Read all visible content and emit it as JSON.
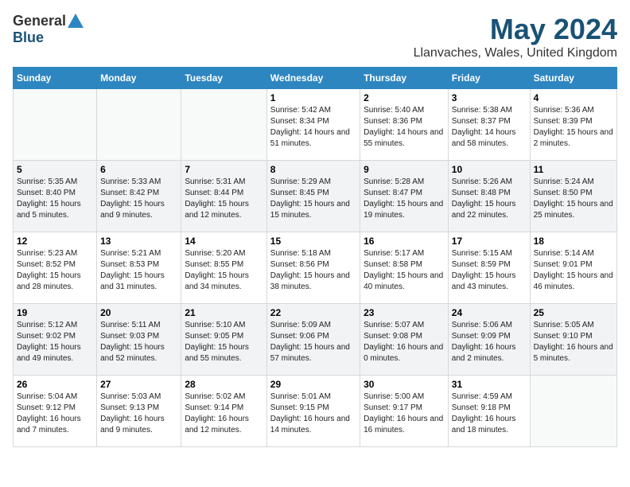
{
  "logo": {
    "general": "General",
    "blue": "Blue"
  },
  "title": "May 2024",
  "subtitle": "Llanvaches, Wales, United Kingdom",
  "days_of_week": [
    "Sunday",
    "Monday",
    "Tuesday",
    "Wednesday",
    "Thursday",
    "Friday",
    "Saturday"
  ],
  "weeks": [
    [
      {
        "day": null,
        "info": null
      },
      {
        "day": null,
        "info": null
      },
      {
        "day": null,
        "info": null
      },
      {
        "day": "1",
        "sunrise": "Sunrise: 5:42 AM",
        "sunset": "Sunset: 8:34 PM",
        "daylight": "Daylight: 14 hours and 51 minutes."
      },
      {
        "day": "2",
        "sunrise": "Sunrise: 5:40 AM",
        "sunset": "Sunset: 8:36 PM",
        "daylight": "Daylight: 14 hours and 55 minutes."
      },
      {
        "day": "3",
        "sunrise": "Sunrise: 5:38 AM",
        "sunset": "Sunset: 8:37 PM",
        "daylight": "Daylight: 14 hours and 58 minutes."
      },
      {
        "day": "4",
        "sunrise": "Sunrise: 5:36 AM",
        "sunset": "Sunset: 8:39 PM",
        "daylight": "Daylight: 15 hours and 2 minutes."
      }
    ],
    [
      {
        "day": "5",
        "sunrise": "Sunrise: 5:35 AM",
        "sunset": "Sunset: 8:40 PM",
        "daylight": "Daylight: 15 hours and 5 minutes."
      },
      {
        "day": "6",
        "sunrise": "Sunrise: 5:33 AM",
        "sunset": "Sunset: 8:42 PM",
        "daylight": "Daylight: 15 hours and 9 minutes."
      },
      {
        "day": "7",
        "sunrise": "Sunrise: 5:31 AM",
        "sunset": "Sunset: 8:44 PM",
        "daylight": "Daylight: 15 hours and 12 minutes."
      },
      {
        "day": "8",
        "sunrise": "Sunrise: 5:29 AM",
        "sunset": "Sunset: 8:45 PM",
        "daylight": "Daylight: 15 hours and 15 minutes."
      },
      {
        "day": "9",
        "sunrise": "Sunrise: 5:28 AM",
        "sunset": "Sunset: 8:47 PM",
        "daylight": "Daylight: 15 hours and 19 minutes."
      },
      {
        "day": "10",
        "sunrise": "Sunrise: 5:26 AM",
        "sunset": "Sunset: 8:48 PM",
        "daylight": "Daylight: 15 hours and 22 minutes."
      },
      {
        "day": "11",
        "sunrise": "Sunrise: 5:24 AM",
        "sunset": "Sunset: 8:50 PM",
        "daylight": "Daylight: 15 hours and 25 minutes."
      }
    ],
    [
      {
        "day": "12",
        "sunrise": "Sunrise: 5:23 AM",
        "sunset": "Sunset: 8:52 PM",
        "daylight": "Daylight: 15 hours and 28 minutes."
      },
      {
        "day": "13",
        "sunrise": "Sunrise: 5:21 AM",
        "sunset": "Sunset: 8:53 PM",
        "daylight": "Daylight: 15 hours and 31 minutes."
      },
      {
        "day": "14",
        "sunrise": "Sunrise: 5:20 AM",
        "sunset": "Sunset: 8:55 PM",
        "daylight": "Daylight: 15 hours and 34 minutes."
      },
      {
        "day": "15",
        "sunrise": "Sunrise: 5:18 AM",
        "sunset": "Sunset: 8:56 PM",
        "daylight": "Daylight: 15 hours and 38 minutes."
      },
      {
        "day": "16",
        "sunrise": "Sunrise: 5:17 AM",
        "sunset": "Sunset: 8:58 PM",
        "daylight": "Daylight: 15 hours and 40 minutes."
      },
      {
        "day": "17",
        "sunrise": "Sunrise: 5:15 AM",
        "sunset": "Sunset: 8:59 PM",
        "daylight": "Daylight: 15 hours and 43 minutes."
      },
      {
        "day": "18",
        "sunrise": "Sunrise: 5:14 AM",
        "sunset": "Sunset: 9:01 PM",
        "daylight": "Daylight: 15 hours and 46 minutes."
      }
    ],
    [
      {
        "day": "19",
        "sunrise": "Sunrise: 5:12 AM",
        "sunset": "Sunset: 9:02 PM",
        "daylight": "Daylight: 15 hours and 49 minutes."
      },
      {
        "day": "20",
        "sunrise": "Sunrise: 5:11 AM",
        "sunset": "Sunset: 9:03 PM",
        "daylight": "Daylight: 15 hours and 52 minutes."
      },
      {
        "day": "21",
        "sunrise": "Sunrise: 5:10 AM",
        "sunset": "Sunset: 9:05 PM",
        "daylight": "Daylight: 15 hours and 55 minutes."
      },
      {
        "day": "22",
        "sunrise": "Sunrise: 5:09 AM",
        "sunset": "Sunset: 9:06 PM",
        "daylight": "Daylight: 15 hours and 57 minutes."
      },
      {
        "day": "23",
        "sunrise": "Sunrise: 5:07 AM",
        "sunset": "Sunset: 9:08 PM",
        "daylight": "Daylight: 16 hours and 0 minutes."
      },
      {
        "day": "24",
        "sunrise": "Sunrise: 5:06 AM",
        "sunset": "Sunset: 9:09 PM",
        "daylight": "Daylight: 16 hours and 2 minutes."
      },
      {
        "day": "25",
        "sunrise": "Sunrise: 5:05 AM",
        "sunset": "Sunset: 9:10 PM",
        "daylight": "Daylight: 16 hours and 5 minutes."
      }
    ],
    [
      {
        "day": "26",
        "sunrise": "Sunrise: 5:04 AM",
        "sunset": "Sunset: 9:12 PM",
        "daylight": "Daylight: 16 hours and 7 minutes."
      },
      {
        "day": "27",
        "sunrise": "Sunrise: 5:03 AM",
        "sunset": "Sunset: 9:13 PM",
        "daylight": "Daylight: 16 hours and 9 minutes."
      },
      {
        "day": "28",
        "sunrise": "Sunrise: 5:02 AM",
        "sunset": "Sunset: 9:14 PM",
        "daylight": "Daylight: 16 hours and 12 minutes."
      },
      {
        "day": "29",
        "sunrise": "Sunrise: 5:01 AM",
        "sunset": "Sunset: 9:15 PM",
        "daylight": "Daylight: 16 hours and 14 minutes."
      },
      {
        "day": "30",
        "sunrise": "Sunrise: 5:00 AM",
        "sunset": "Sunset: 9:17 PM",
        "daylight": "Daylight: 16 hours and 16 minutes."
      },
      {
        "day": "31",
        "sunrise": "Sunrise: 4:59 AM",
        "sunset": "Sunset: 9:18 PM",
        "daylight": "Daylight: 16 hours and 18 minutes."
      },
      {
        "day": null,
        "info": null
      }
    ]
  ]
}
